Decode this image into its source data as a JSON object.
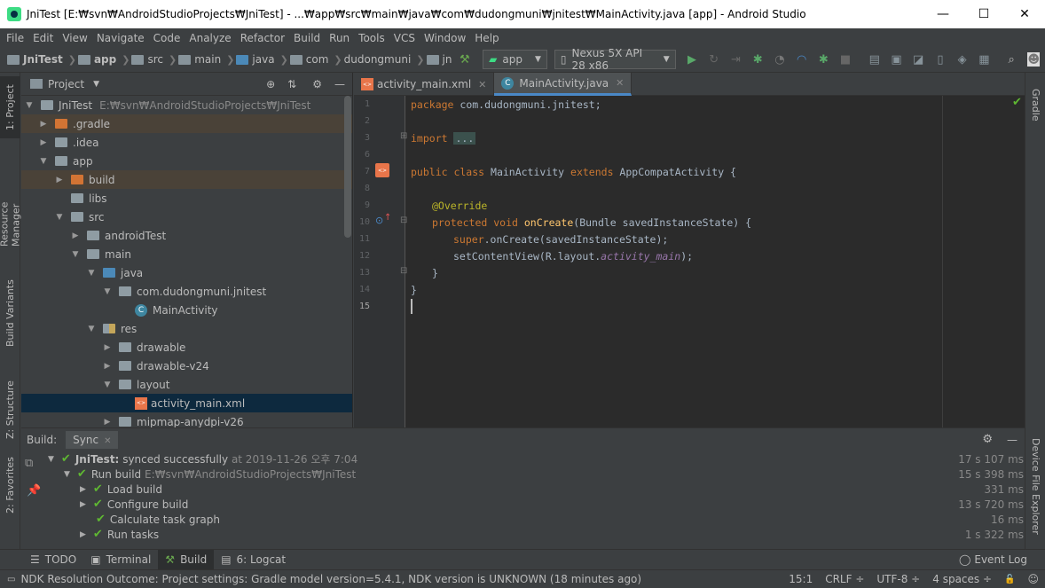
{
  "window": {
    "title": "JniTest [E:₩svn₩AndroidStudioProjects₩JniTest] - ...₩app₩src₩main₩java₩com₩dudongmuni₩jnitest₩MainActivity.java [app] - Android Studio",
    "minimize": "—",
    "maximize": "☐",
    "close": "✕"
  },
  "menu": [
    "File",
    "Edit",
    "View",
    "Navigate",
    "Code",
    "Analyze",
    "Refactor",
    "Build",
    "Run",
    "Tools",
    "VCS",
    "Window",
    "Help"
  ],
  "breadcrumb": [
    "JniTest",
    "app",
    "src",
    "main",
    "java",
    "com",
    "dudongmuni",
    "jn"
  ],
  "toolbar": {
    "config": "app",
    "device": "Nexus 5X API 28 x86"
  },
  "left_tabs": [
    "1: Project",
    "Resource Manager",
    "Build Variants",
    "Z: Structure",
    "2: Favorites"
  ],
  "right_tabs": [
    "Gradle",
    "Device File Explorer"
  ],
  "project": {
    "header": "Project",
    "tree": [
      {
        "label": "JniTest",
        "extra": "E:₩svn₩AndroidStudioProjects₩JniTest"
      },
      {
        "label": ".gradle"
      },
      {
        "label": ".idea"
      },
      {
        "label": "app"
      },
      {
        "label": "build"
      },
      {
        "label": "libs"
      },
      {
        "label": "src"
      },
      {
        "label": "androidTest"
      },
      {
        "label": "main"
      },
      {
        "label": "java"
      },
      {
        "label": "com.dudongmuni.jnitest"
      },
      {
        "label": "MainActivity"
      },
      {
        "label": "res"
      },
      {
        "label": "drawable"
      },
      {
        "label": "drawable-v24"
      },
      {
        "label": "layout"
      },
      {
        "label": "activity_main.xml"
      },
      {
        "label": "mipmap-anydpi-v26"
      }
    ]
  },
  "editor": {
    "tabs": [
      {
        "label": "activity_main.xml"
      },
      {
        "label": "MainActivity.java"
      }
    ],
    "line_numbers": [
      "1",
      "2",
      "3",
      "6",
      "7",
      "8",
      "9",
      "10",
      "11",
      "12",
      "13",
      "14",
      "15"
    ],
    "code": {
      "l1_kw": "package",
      "l1_rest": " com.dudongmuni.jnitest;",
      "l3_kw": "import",
      "l3_fold": "...",
      "l7_a": "public class",
      "l7_b": " MainActivity ",
      "l7_c": "extends",
      "l7_d": " AppCompatActivity {",
      "l9": "@Override",
      "l10_a": "protected void",
      "l10_b": "onCreate",
      "l10_c": "(Bundle savedInstanceState) {",
      "l11_a": "super",
      "l11_b": ".onCreate(savedInstanceState);",
      "l12_a": "setContentView(R.layout.",
      "l12_b": "activity_main",
      "l12_c": ");",
      "l13": "}",
      "l14": "}"
    }
  },
  "build": {
    "tab_label": "Build:",
    "sync_tab": "Sync",
    "rows": [
      {
        "label": "JniTest:",
        "rest": "synced successfully",
        "extra": "at 2019-11-26 오후 7:04",
        "time": "17 s 107 ms"
      },
      {
        "label": "Run build",
        "extra": "E:₩svn₩AndroidStudioProjects₩JniTest",
        "time": "15 s 398 ms"
      },
      {
        "label": "Load build",
        "time": "331 ms"
      },
      {
        "label": "Configure build",
        "time": "13 s 720 ms"
      },
      {
        "label": "Calculate task graph",
        "time": "16 ms"
      },
      {
        "label": "Run tasks",
        "time": "1 s 322 ms"
      }
    ]
  },
  "bottom_tabs": [
    "TODO",
    "Terminal",
    "Build",
    "6: Logcat"
  ],
  "event_log": "Event Log",
  "status": {
    "message": "NDK Resolution Outcome: Project settings: Gradle model version=5.4.1, NDK version is UNKNOWN (18 minutes ago)",
    "position": "15:1",
    "line_sep": "CRLF ÷",
    "encoding": "UTF-8 ÷",
    "indent": "4 spaces ÷"
  }
}
